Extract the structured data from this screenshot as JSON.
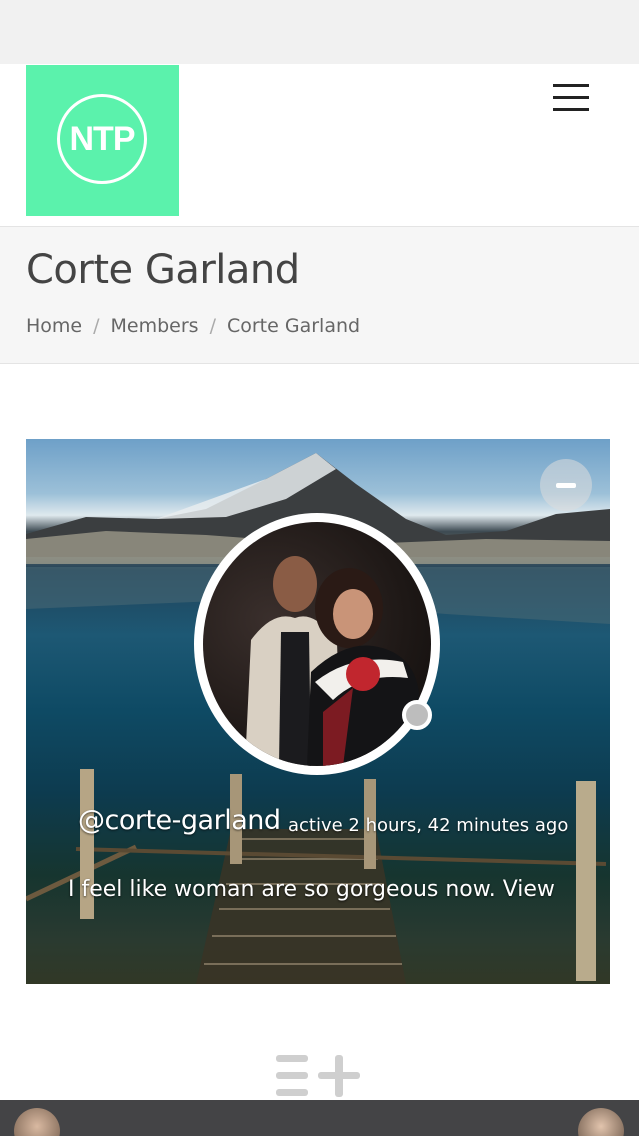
{
  "header": {
    "logo_text": "NTP",
    "logo_color": "#5bf2ac",
    "menu_icon": "hamburger-menu-icon"
  },
  "page": {
    "title": "Corte Garland",
    "breadcrumb": [
      "Home",
      "Members",
      "Corte Garland"
    ],
    "breadcrumb_separator": "/"
  },
  "profile": {
    "username": "@corte-garland",
    "active": "active 2 hours, 42 minutes ago",
    "status_text": "I feel like woman are so gorgeous now.",
    "status_link": "View",
    "collapse_icon": "minus-icon",
    "online_status_color": "#bdbdbd"
  },
  "footer": {
    "follow_icon": "list-add-icon"
  }
}
